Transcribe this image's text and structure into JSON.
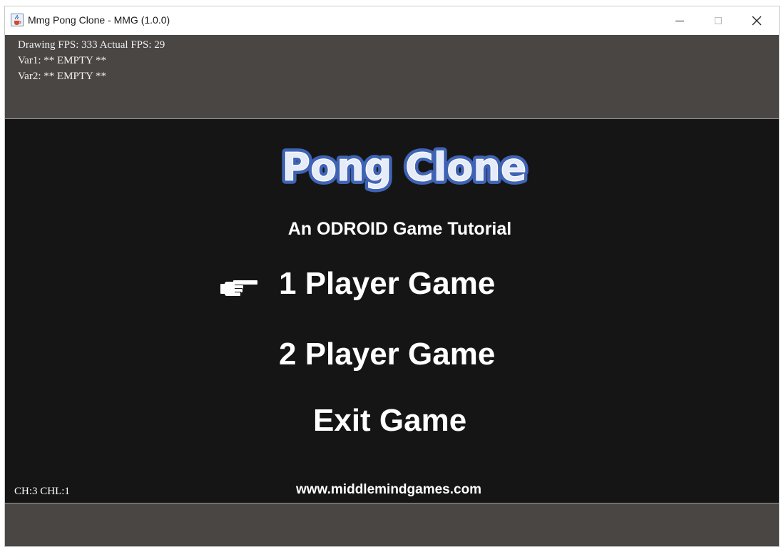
{
  "window": {
    "title": "Mmg Pong Clone - MMG (1.0.0)",
    "icons": {
      "app": "java-cup-icon",
      "minimize": "minimize-icon",
      "maximize": "maximize-icon",
      "close": "close-icon"
    }
  },
  "debug": {
    "line1": "Drawing FPS: 333 Actual FPS: 29",
    "line2": "Var1: ** EMPTY **",
    "line3": "Var2: ** EMPTY **"
  },
  "game": {
    "logo_text": "Pong Clone",
    "subtitle": "An ODROID Game Tutorial",
    "menu": [
      {
        "label": "1 Player Game",
        "selected": true
      },
      {
        "label": "2 Player Game",
        "selected": false
      },
      {
        "label": "Exit Game",
        "selected": false
      }
    ],
    "pointer_icon": "pointing-hand-icon",
    "channel_status": "CH:3 CHL:1",
    "website": "www.middlemindgames.com"
  },
  "colors": {
    "panel_bg": "#4a4644",
    "game_bg": "#151515",
    "logo_fill": "#e6ecf7",
    "logo_outline": "#3f63b5"
  }
}
